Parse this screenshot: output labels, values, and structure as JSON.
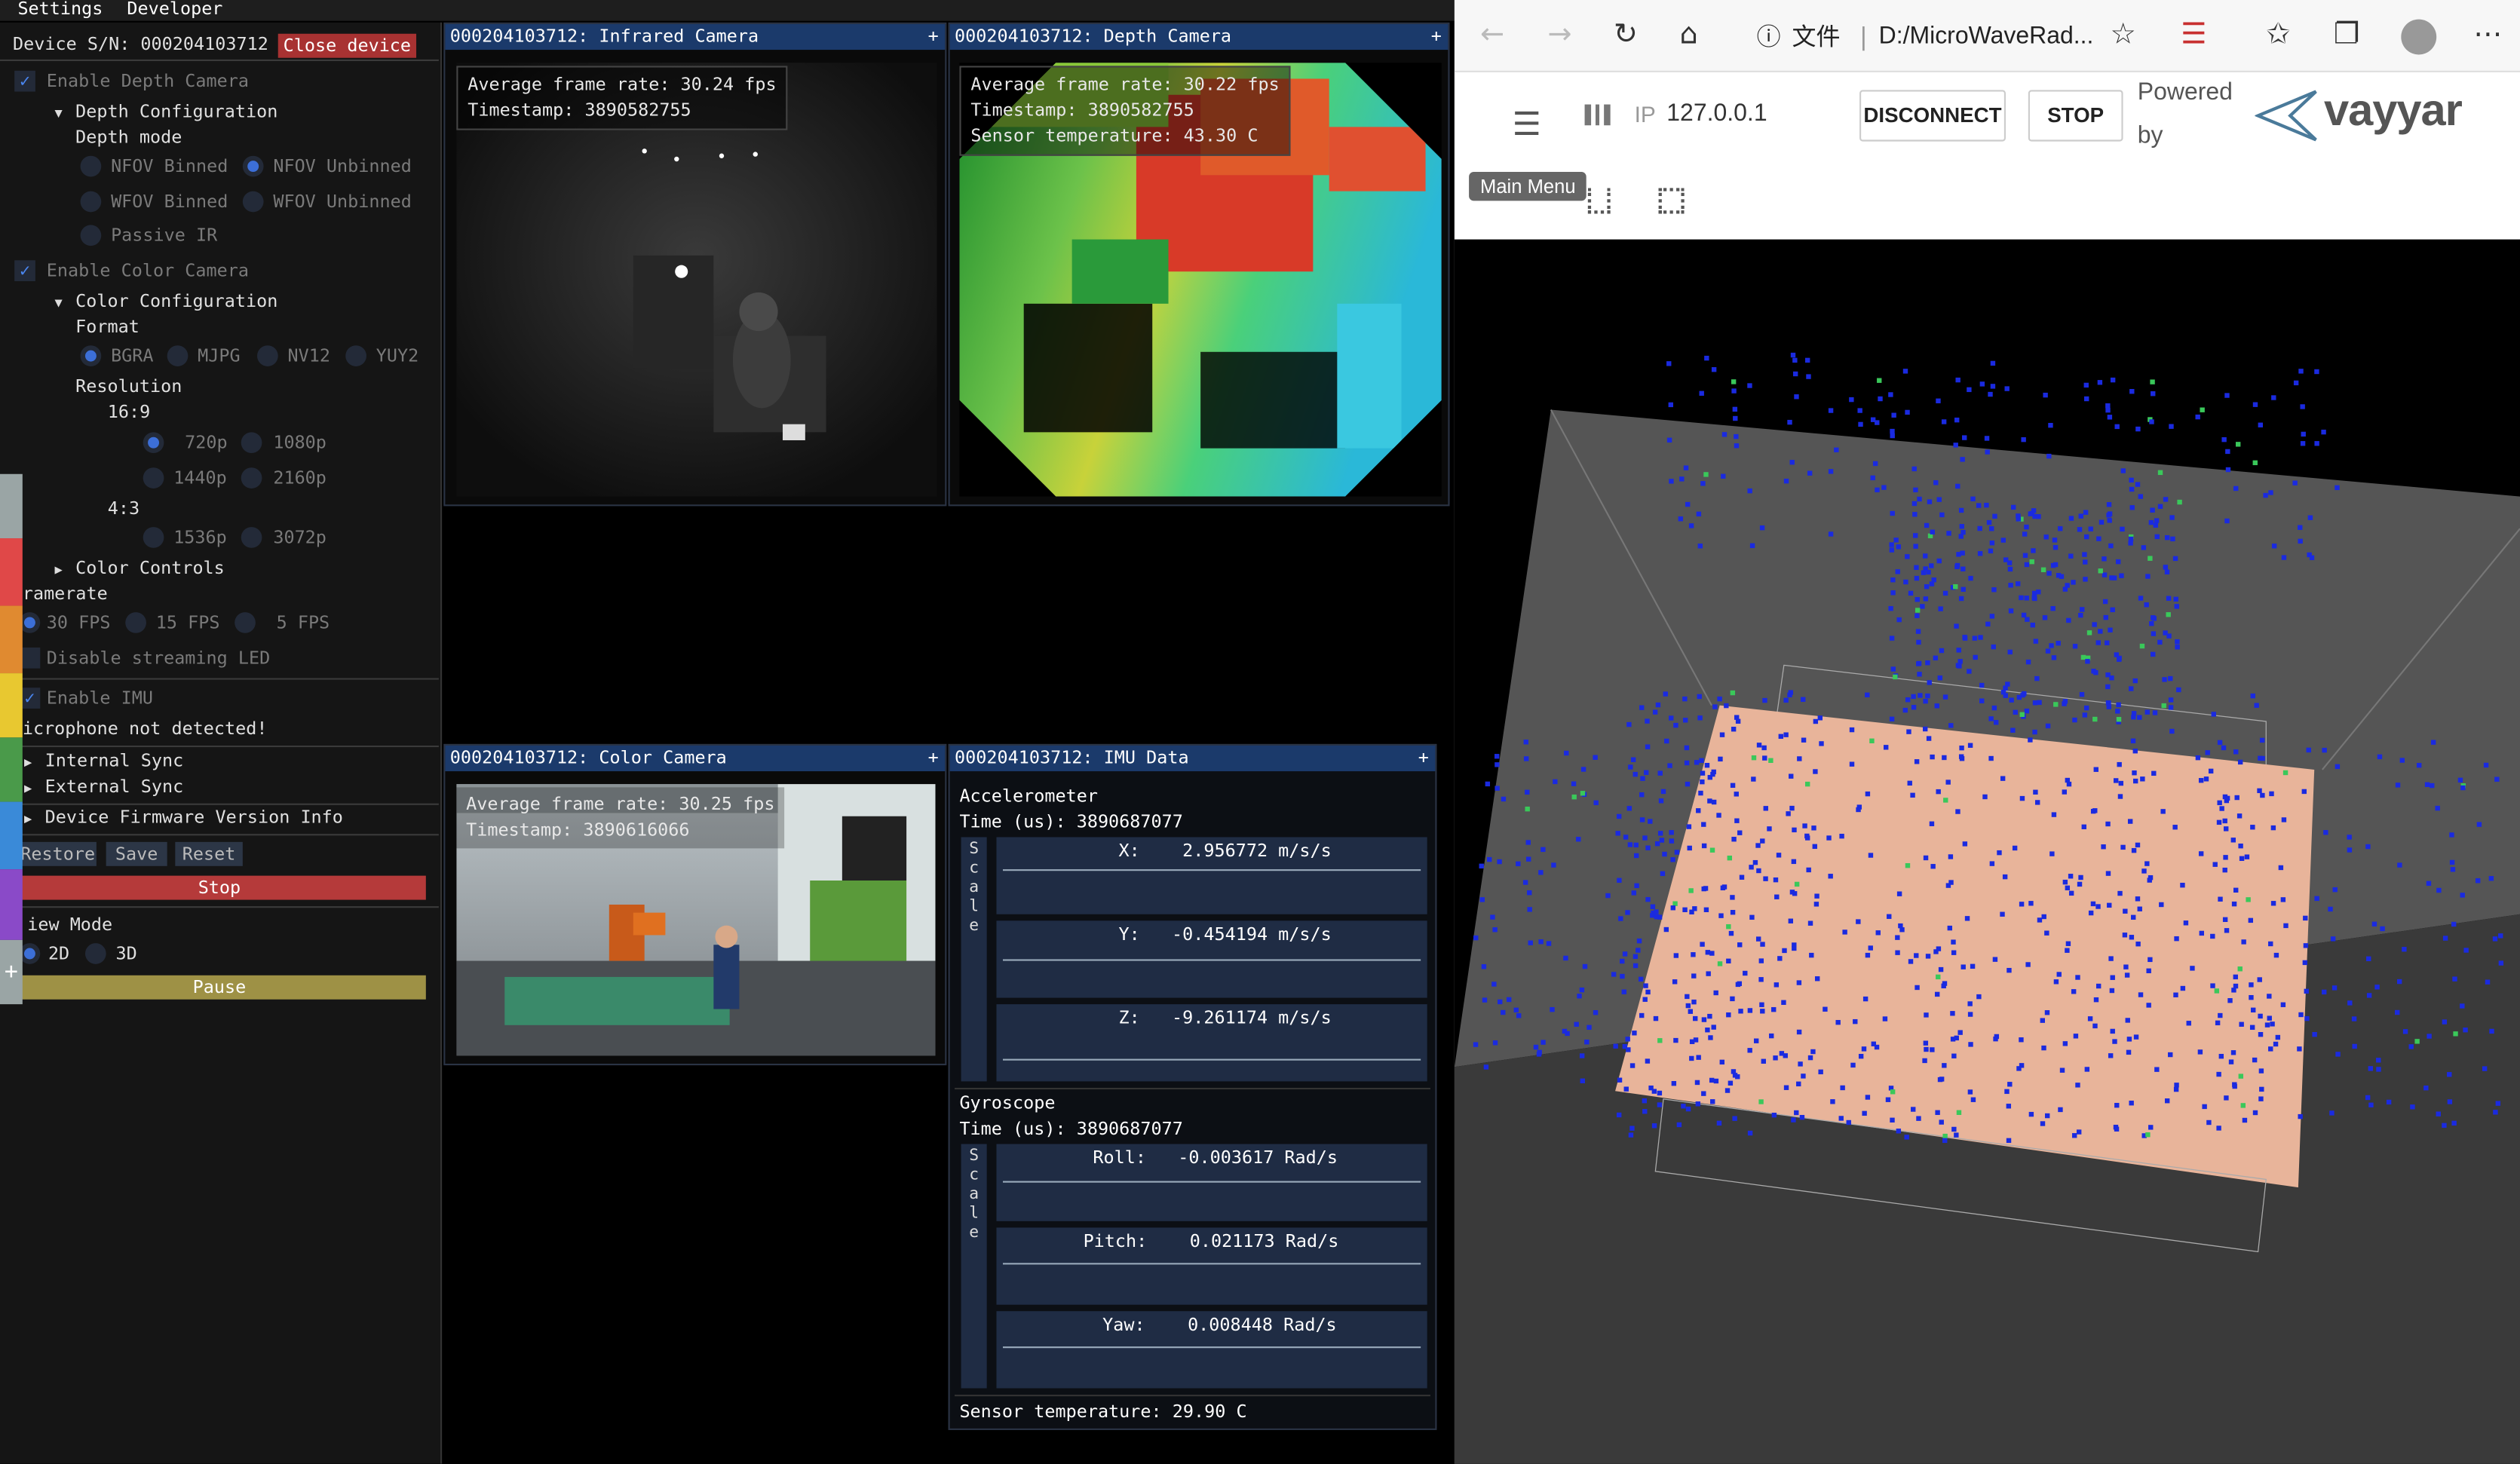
{
  "menubar": {
    "settings": "Settings",
    "developer": "Developer"
  },
  "device": {
    "sn_label": "Device S/N: 000204103712",
    "close_button": "Close device"
  },
  "depth": {
    "enable_label": "Enable Depth Camera",
    "config_label": "Depth Configuration",
    "mode_label": "Depth mode",
    "modes": [
      "NFOV Binned",
      "NFOV Unbinned",
      "WFOV Binned",
      "WFOV Unbinned",
      "Passive IR"
    ],
    "selected_mode": "NFOV Unbinned"
  },
  "color": {
    "enable_label": "Enable Color Camera",
    "config_label": "Color Configuration",
    "format_label": "Format",
    "formats": [
      "BGRA",
      "MJPG",
      "NV12",
      "YUY2"
    ],
    "selected_format": "BGRA",
    "resolution_label": "Resolution",
    "ratio_169": "16:9",
    "res_169": [
      "720p",
      "1080p",
      "1440p",
      "2160p"
    ],
    "ratio_43": "4:3",
    "res_43": [
      "1536p",
      "3072p"
    ],
    "selected_res": "720p",
    "controls_label": "Color Controls"
  },
  "framerate": {
    "label": "ramerate",
    "options": [
      "30 FPS",
      "15 FPS",
      "5 FPS"
    ],
    "selected": "30 FPS"
  },
  "led_label": "Disable streaming LED",
  "imu_label": "Enable IMU",
  "mic_label": "icrophone not detected!",
  "sync": {
    "internal": "Internal Sync",
    "external": "External Sync"
  },
  "firmware_label": "Device Firmware Version Info",
  "actions": {
    "restore": "Restore",
    "save": "Save",
    "reset": "Reset",
    "stop": "Stop",
    "pause": "Pause"
  },
  "viewmode": {
    "label": "iew Mode",
    "options": [
      "2D",
      "3D"
    ],
    "selected": "2D"
  },
  "sidebar_colors": [
    "#9aa5a5",
    "#e04848",
    "#e08a30",
    "#e8c830",
    "#4a9a4a",
    "#3a8ad8",
    "#8a4ac8",
    "#9aa5a5"
  ],
  "windows": {
    "ir": {
      "title": "000204103712: Infrared Camera",
      "plus": "+",
      "fps": "Average frame rate: 30.24 fps",
      "ts": "Timestamp: 3890582755"
    },
    "depth": {
      "title": "000204103712: Depth Camera",
      "plus": "+",
      "fps": "Average frame rate: 30.22 fps",
      "ts": "Timestamp: 3890582755",
      "temp": "Sensor temperature: 43.30 C"
    },
    "color": {
      "title": "000204103712: Color Camera",
      "plus": "+",
      "fps": "Average frame rate: 30.25 fps",
      "ts": "Timestamp: 3890616066"
    },
    "imu": {
      "title": "000204103712: IMU Data",
      "plus": "+",
      "accel_label": "Accelerometer",
      "accel_time": "Time (us): 3890687077",
      "ax": "X:    2.956772 m/s/s",
      "ay": "Y:   -0.454194 m/s/s",
      "az": "Z:   -9.261174 m/s/s",
      "gyro_label": "Gyroscope",
      "gyro_time": "Time (us): 3890687077",
      "roll": "Roll:   -0.003617 Rad/s",
      "pitch": "Pitch:    0.021173 Rad/s",
      "yaw": "Yaw:    0.008448 Rad/s",
      "scale_label": "Scale",
      "temp": "Sensor temperature: 29.90 C"
    }
  },
  "browser": {
    "zh_label": "文件",
    "address": "D:/MicroWaveRad...",
    "ip_label": "IP",
    "ip_value": "127.0.0.1",
    "disconnect": "DISCONNECT",
    "stop": "STOP",
    "powered_by_1": "Powered",
    "powered_by_2": "by",
    "brand": "vayyar",
    "tooltip": "Main Menu",
    "icons": [
      "back-arrow-icon",
      "forward-arrow-icon",
      "refresh-icon",
      "home-icon",
      "info-icon",
      "star-add-icon",
      "extension-icon",
      "favorites-icon",
      "collections-icon",
      "profile-icon",
      "more-icon",
      "hamburger-icon",
      "columns-icon",
      "selection-icon",
      "grid-icon"
    ]
  }
}
